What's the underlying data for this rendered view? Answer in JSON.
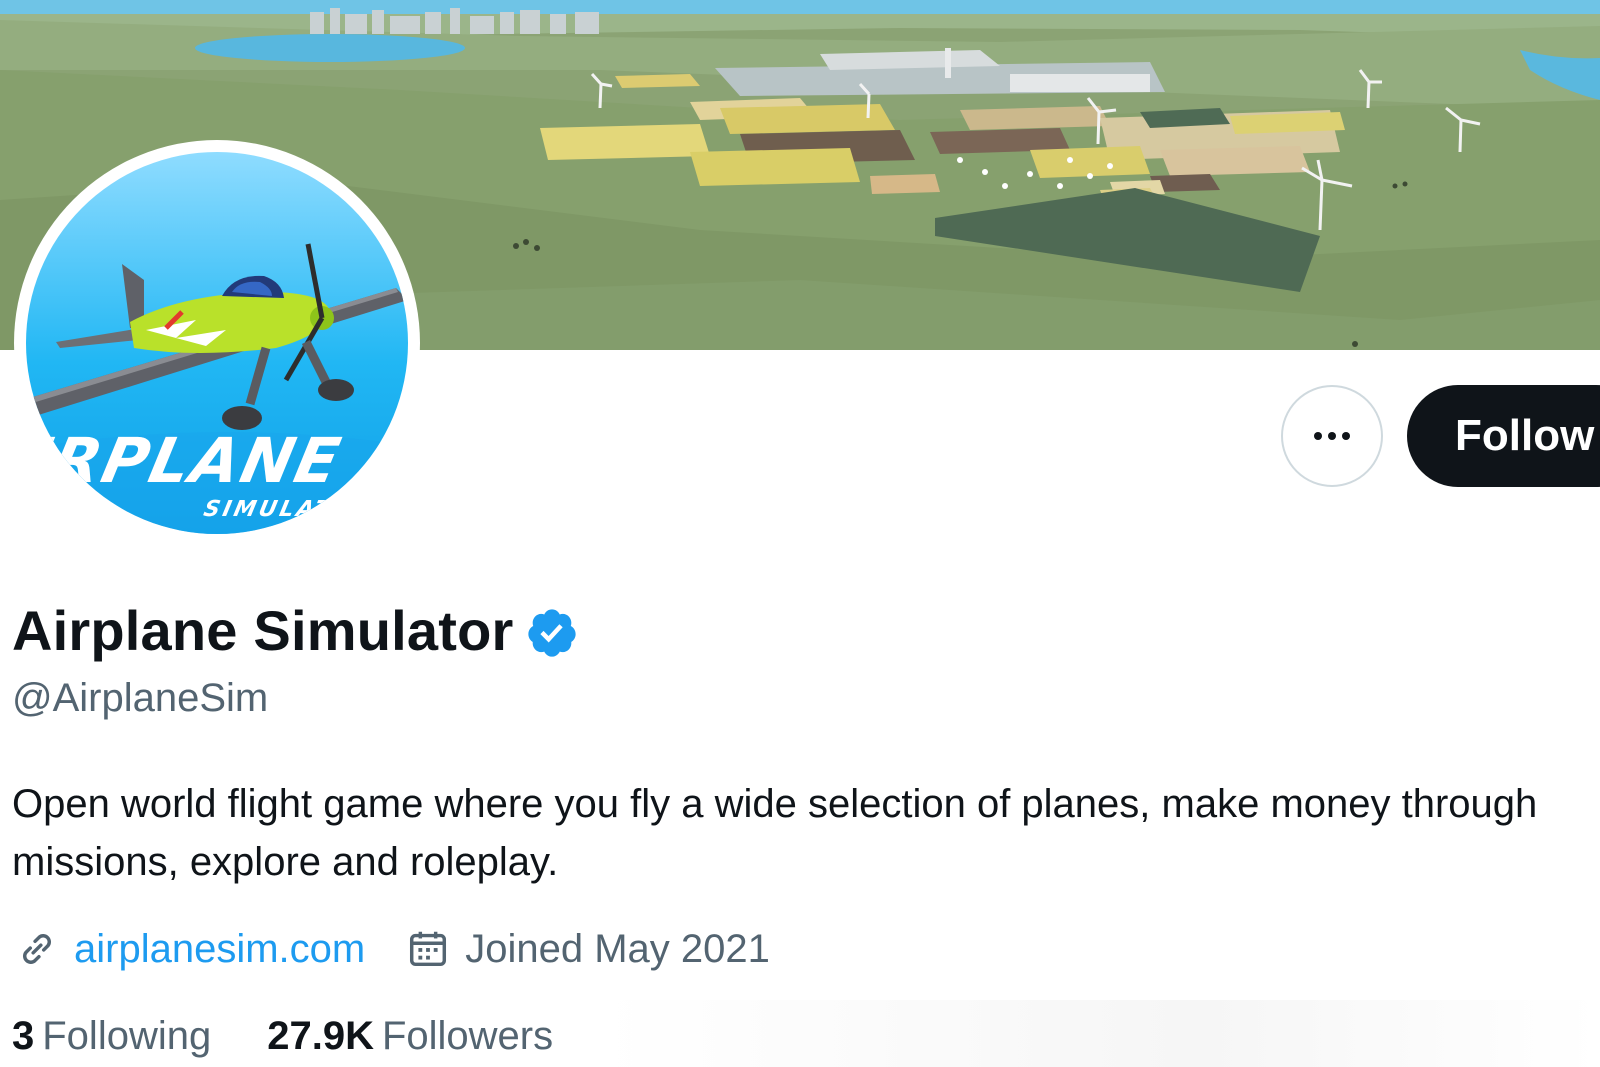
{
  "banner": {
    "scene": "aerial view of airport, farm fields and wind turbines"
  },
  "avatar": {
    "title_text": "AIRPLANE",
    "subtitle_text": "SIMULATOR"
  },
  "actions": {
    "more_icon": "more-horizontal-icon",
    "follow_label": "Follow"
  },
  "profile": {
    "display_name": "Airplane Simulator",
    "verified_icon": "verified-badge-icon",
    "handle": "@AirplaneSim",
    "bio": "Open world flight game where you fly a wide selection of planes, make money through missions, explore and roleplay.",
    "website_icon": "link-icon",
    "website": "airplanesim.com",
    "joined_icon": "calendar-icon",
    "joined": "Joined May 2021"
  },
  "stats": {
    "following_count": "3",
    "following_label": "Following",
    "followers_count": "27.9K",
    "followers_label": "Followers"
  },
  "colors": {
    "accent": "#1d9bf0",
    "text_primary": "#0f1419",
    "text_secondary": "#536471",
    "button_dark": "#0f1419",
    "border": "#cfd9de"
  }
}
